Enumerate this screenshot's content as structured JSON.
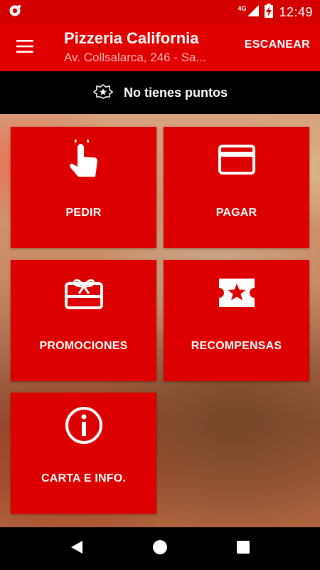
{
  "status_bar": {
    "network": "4G",
    "time": "12:49"
  },
  "app_bar": {
    "title": "Pizzeria California",
    "subtitle": "Av. Collsalarca, 246 - Sa...",
    "scan_label": "ESCANEAR"
  },
  "points": {
    "text": "No tienes puntos"
  },
  "tiles": [
    {
      "label": "PEDIR",
      "icon": "tap-finger-icon"
    },
    {
      "label": "PAGAR",
      "icon": "credit-card-icon"
    },
    {
      "label": "PROMOCIONES",
      "icon": "gift-card-icon"
    },
    {
      "label": "RECOMPENSAS",
      "icon": "ticket-star-icon"
    },
    {
      "label": "CARTA E INFO.",
      "icon": "info-icon"
    }
  ],
  "colors": {
    "status_bar": "#d40000",
    "app_bar": "#e00000",
    "tile": "#dd0000",
    "points_bar": "#000000",
    "subtitle": "#ffb3b3"
  }
}
